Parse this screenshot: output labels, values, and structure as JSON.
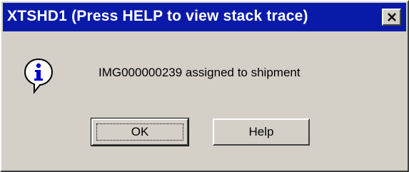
{
  "dialog": {
    "title": "XTSHD1 (Press HELP to view stack trace)",
    "close_label": "×",
    "icon": "information-icon",
    "message": "IMG000000239 assigned to shipment"
  },
  "buttons": {
    "ok_label": "OK",
    "help_label": "Help"
  },
  "colors": {
    "titlebar": "#0a1aa8",
    "face": "#d4d0c8",
    "icon_blue": "#0000cc"
  }
}
